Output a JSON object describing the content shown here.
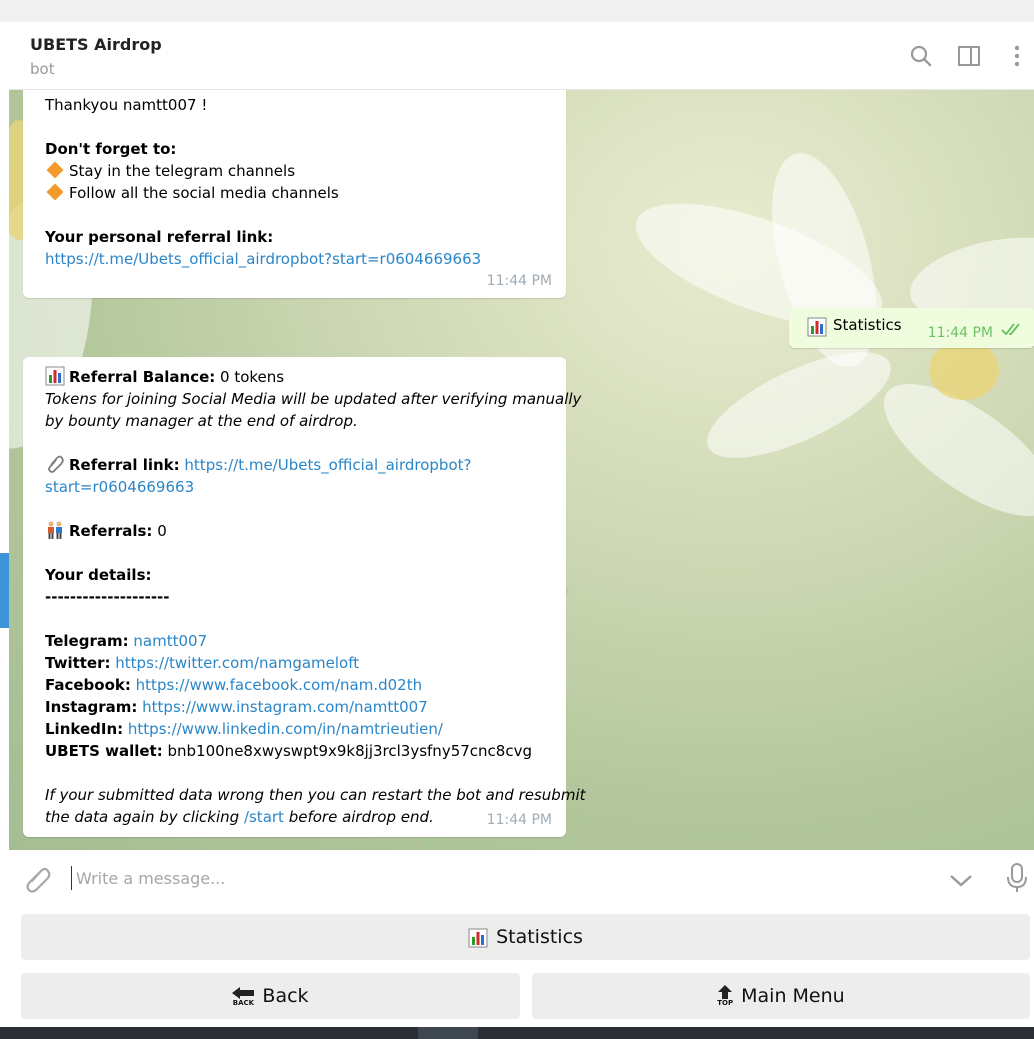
{
  "header": {
    "title": "UBETS Airdrop",
    "subtitle": "bot",
    "icons": [
      "search-icon",
      "sidebar-toggle-icon",
      "more-vertical-icon"
    ]
  },
  "messages": {
    "m1": {
      "thanks": "Thankyou namtt007 !",
      "dont_forget": "Don't forget to:",
      "item1": "Stay in the telegram channels",
      "item2": "Follow all the social media channels",
      "ref_label": "Your personal referral link:",
      "ref_link": "https://t.me/Ubets_official_airdropbot?start=r0604669663",
      "time": "11:44 PM"
    },
    "out": {
      "text": "Statistics",
      "time": "11:44 PM"
    },
    "m2": {
      "balance_label": "Referral Balance:",
      "balance_value": " 0 tokens",
      "note1": "Tokens for joining Social Media will be updated after verifying manually",
      "note2": "by bounty manager at the end of airdrop.",
      "reflink_label": "Referral link:",
      "reflink_part1": "https://t.me/Ubets_official_airdropbot?",
      "reflink_part2": "start=r0604669663",
      "referrals_label": "Referrals:",
      "referrals_value": " 0",
      "details_label": "Your details:",
      "divider": "--------------------",
      "telegram_label": "Telegram:",
      "telegram_value": "namtt007",
      "twitter_label": "Twitter:",
      "twitter_value": "https://twitter.com/namgameloft",
      "facebook_label": "Facebook:",
      "facebook_value": "https://www.facebook.com/nam.d02th",
      "instagram_label": "Instagram:",
      "instagram_value": "https://www.instagram.com/namtt007",
      "linkedin_label": "LinkedIn:",
      "linkedin_value": "https://www.linkedin.com/in/namtrieutien/",
      "wallet_label": "UBETS wallet:",
      "wallet_value": " bnb100ne8xwyswpt9x9k8jj3rcl3ysfny57cnc8cvg",
      "footer1": "If your submitted data wrong then you can restart the bot and resubmit",
      "footer2_a": "the data again by clicking ",
      "footer2_link": "/start",
      "footer2_b": " before airdrop end.",
      "time": "11:44 PM"
    }
  },
  "composer": {
    "placeholder": "Write a message..."
  },
  "keyboard": {
    "statistics": "Statistics",
    "back": "Back",
    "back_icon_text": "BACK",
    "main_menu": "Main Menu",
    "top_icon_text": "TOP"
  },
  "colors": {
    "link": "#2a86c8",
    "outgoing_bubble": "#effdde",
    "outgoing_time": "#6cc264",
    "accent": "#3b95d8"
  }
}
